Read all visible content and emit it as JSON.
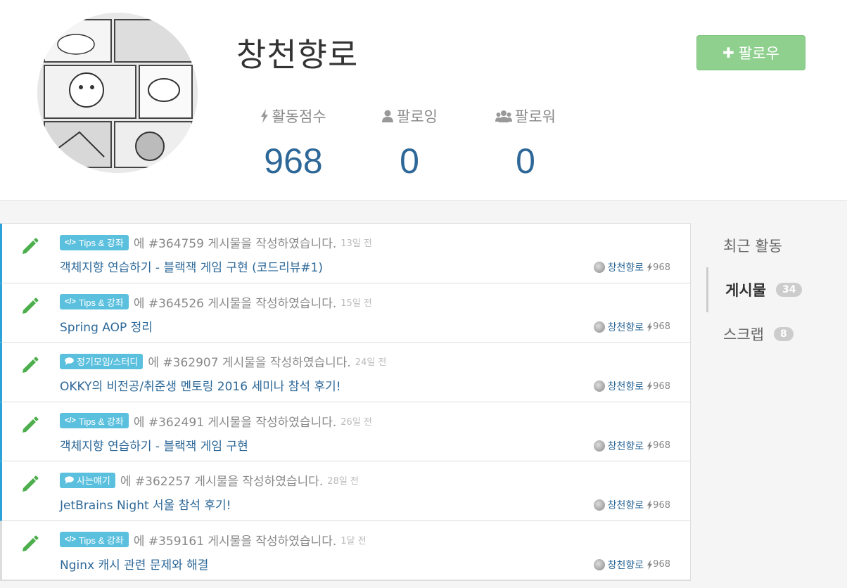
{
  "profile": {
    "nickname": "창천향로",
    "follow_label": "팔로우",
    "stats": {
      "score_label": "활동점수",
      "score_value": "968",
      "following_label": "팔로잉",
      "following_value": "0",
      "follower_label": "팔로워",
      "follower_value": "0"
    },
    "icons": [
      "lightning-icon",
      "user-icon",
      "users-icon",
      "plus-icon"
    ]
  },
  "activity": [
    {
      "tag": "Tips & 강좌",
      "tag_icon": "code-icon",
      "prefix": "에",
      "text": "#364759 게시물을 작성하였습니다.",
      "time": "13일 전",
      "title": "객체지향 연습하기 - 블랙잭 게임 구현 (코드리뷰#1)",
      "author": "창천향로",
      "author_score": "968"
    },
    {
      "tag": "Tips & 강좌",
      "tag_icon": "code-icon",
      "prefix": "에",
      "text": "#364526 게시물을 작성하였습니다.",
      "time": "15일 전",
      "title": "Spring AOP 정리",
      "author": "창천향로",
      "author_score": "968"
    },
    {
      "tag": "정기모임/스터디",
      "tag_icon": "comment-icon",
      "prefix": "에",
      "text": "#362907 게시물을 작성하였습니다.",
      "time": "24일 전",
      "title": "OKKY의 비전공/취준생 멘토링 2016 세미나 참석 후기!",
      "author": "창천향로",
      "author_score": "968"
    },
    {
      "tag": "Tips & 강좌",
      "tag_icon": "code-icon",
      "prefix": "에",
      "text": "#362491 게시물을 작성하였습니다.",
      "time": "26일 전",
      "title": "객체지향 연습하기 - 블랙잭 게임 구현",
      "author": "창천향로",
      "author_score": "968"
    },
    {
      "tag": "사는얘기",
      "tag_icon": "comment-icon",
      "prefix": "에",
      "text": "#362257 게시물을 작성하였습니다.",
      "time": "28일 전",
      "title": "JetBrains Night 서울 참석 후기!",
      "author": "창천향로",
      "author_score": "968"
    },
    {
      "tag": "Tips & 강좌",
      "tag_icon": "code-icon",
      "prefix": "에",
      "text": "#359161 게시물을 작성하였습니다.",
      "time": "1달 전",
      "title": "Nginx 캐시 관련 문제와 해결",
      "author": "창천향로",
      "author_score": "968"
    }
  ],
  "sidebar": {
    "items": [
      {
        "label": "최근 활동",
        "count": ""
      },
      {
        "label": "게시물",
        "count": "34",
        "active": true
      },
      {
        "label": "스크랩",
        "count": "8"
      }
    ]
  },
  "colors": {
    "accent": "#2ba3d8",
    "link": "#2d6898",
    "follow_button": "#8fd08f",
    "tag": "#5bc0de",
    "pencil": "#4cae4c"
  }
}
